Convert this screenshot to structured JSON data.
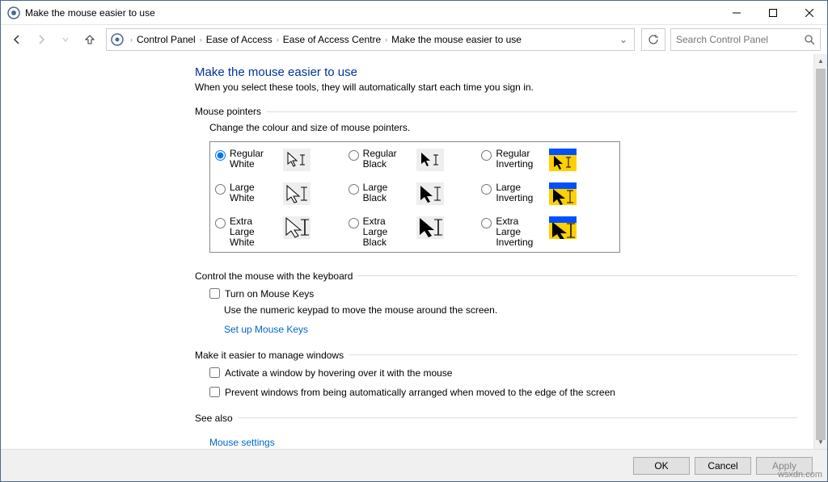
{
  "window": {
    "title": "Make the mouse easier to use"
  },
  "breadcrumb": {
    "items": [
      "Control Panel",
      "Ease of Access",
      "Ease of Access Centre",
      "Make the mouse easier to use"
    ]
  },
  "search": {
    "placeholder": "Search Control Panel"
  },
  "page": {
    "heading": "Make the mouse easier to use",
    "subheading": "When you select these tools, they will automatically start each time you sign in."
  },
  "pointers": {
    "header": "Mouse pointers",
    "desc": "Change the colour and size of mouse pointers.",
    "options": [
      {
        "label": "Regular White",
        "checked": true
      },
      {
        "label": "Regular Black",
        "checked": false
      },
      {
        "label": "Regular Inverting",
        "checked": false
      },
      {
        "label": "Large White",
        "checked": false
      },
      {
        "label": "Large Black",
        "checked": false
      },
      {
        "label": "Large Inverting",
        "checked": false
      },
      {
        "label": "Extra Large White",
        "checked": false
      },
      {
        "label": "Extra Large Black",
        "checked": false
      },
      {
        "label": "Extra Large Inverting",
        "checked": false
      }
    ]
  },
  "keyboard": {
    "header": "Control the mouse with the keyboard",
    "check1": "Turn on Mouse Keys",
    "desc1": "Use the numeric keypad to move the mouse around the screen.",
    "link1": "Set up Mouse Keys"
  },
  "windows": {
    "header": "Make it easier to manage windows",
    "check1": "Activate a window by hovering over it with the mouse",
    "check2": "Prevent windows from being automatically arranged when moved to the edge of the screen"
  },
  "seealso": {
    "header": "See also",
    "link1": "Mouse settings"
  },
  "footer": {
    "ok": "OK",
    "cancel": "Cancel",
    "apply": "Apply"
  },
  "watermark": "wsxdn.com"
}
